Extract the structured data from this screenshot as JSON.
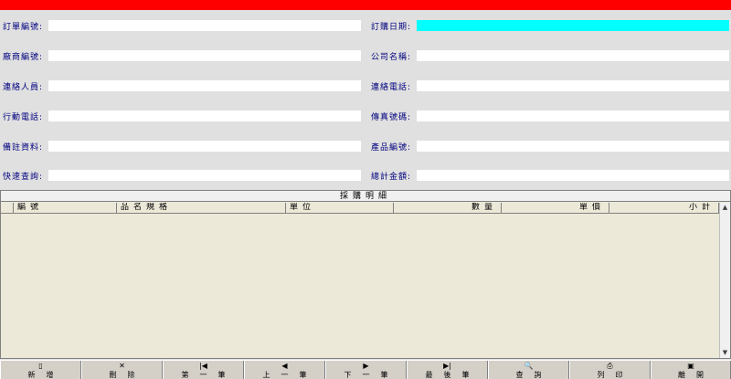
{
  "form": {
    "left": [
      {
        "label": "訂單編號:",
        "value": ""
      },
      {
        "label": "廠商編號:",
        "value": ""
      },
      {
        "label": "連絡人員:",
        "value": ""
      },
      {
        "label": "行動電話:",
        "value": ""
      },
      {
        "label": "備註資料:",
        "value": ""
      },
      {
        "label": "快速查詢:",
        "value": ""
      }
    ],
    "right": [
      {
        "label": "訂購日期:",
        "value": ""
      },
      {
        "label": "公司名稱:",
        "value": ""
      },
      {
        "label": "連絡電話:",
        "value": ""
      },
      {
        "label": "傳真號碼:",
        "value": ""
      },
      {
        "label": "產品編號:",
        "value": ""
      },
      {
        "label": "總計金額:",
        "value": ""
      }
    ],
    "highlight_color": "#00ffff"
  },
  "detail": {
    "title": "採購明細",
    "columns": [
      "編號",
      "品名規格",
      "單位",
      "數量",
      "單價",
      "小計"
    ]
  },
  "toolbar": {
    "buttons": [
      {
        "label": "新增",
        "icon": "new-document-icon"
      },
      {
        "label": "刪除",
        "icon": "delete-x-icon"
      },
      {
        "label": "第一筆",
        "icon": "first-record-icon"
      },
      {
        "label": "上一筆",
        "icon": "previous-record-icon"
      },
      {
        "label": "下一筆",
        "icon": "next-record-icon"
      },
      {
        "label": "最後筆",
        "icon": "last-record-icon"
      },
      {
        "label": "查詢",
        "icon": "search-document-icon"
      },
      {
        "label": "列印",
        "icon": "printer-icon"
      },
      {
        "label": "離開",
        "icon": "save-disk-icon"
      }
    ]
  },
  "colors": {
    "title_bar": "#ff0000",
    "label_text": "#000080"
  }
}
